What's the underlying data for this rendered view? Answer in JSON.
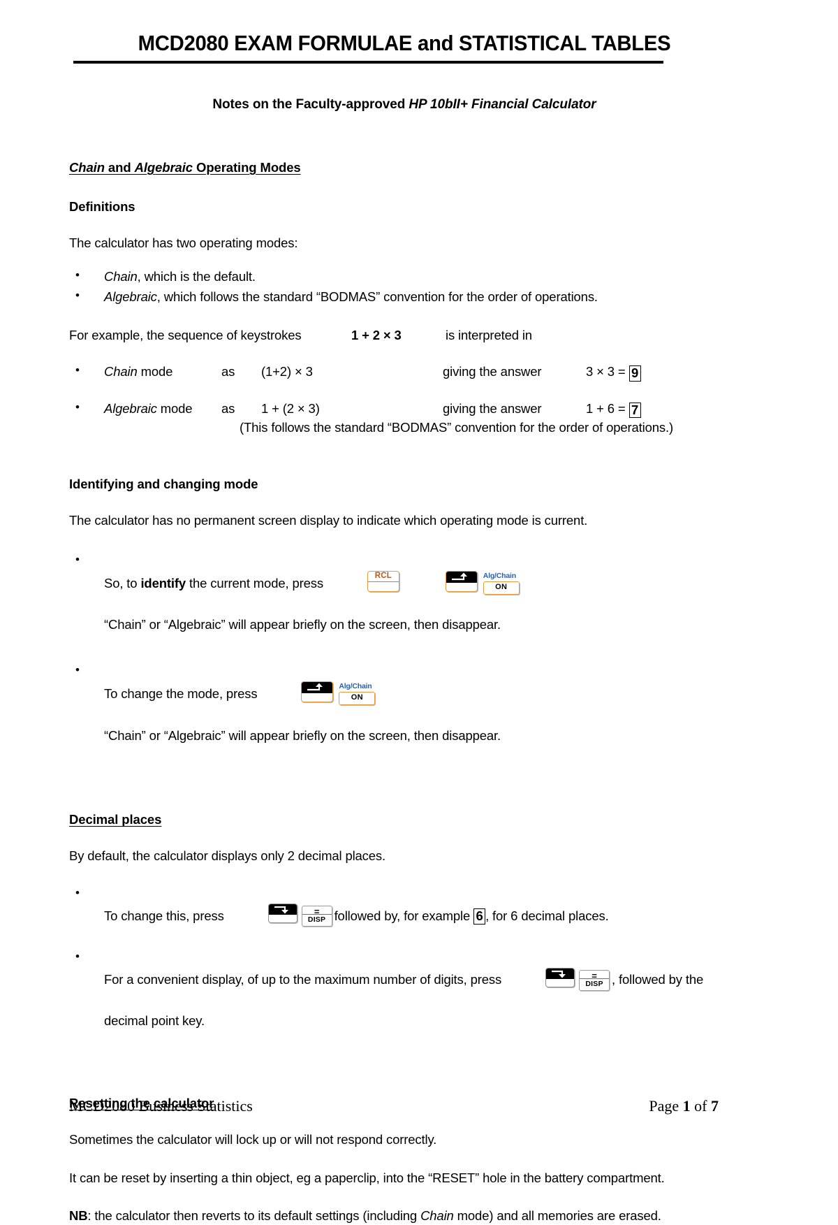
{
  "document": {
    "title": "MCD2080 EXAM FORMULAE and STATISTICAL TABLES",
    "subtitle_prefix": "Notes on the Faculty-approved ",
    "subtitle_calculator": "HP 10bII+ Financial Calculator"
  },
  "sections": {
    "modes": {
      "heading_chain": "Chain",
      "heading_and": " and ",
      "heading_algebraic": "Algebraic",
      "heading_rest": " Operating Modes",
      "definitions_heading": "Definitions",
      "intro": "The calculator has two operating modes:",
      "bullets": [
        {
          "term": "Chain",
          "rest": ", which is the default."
        },
        {
          "term": "Algebraic",
          "rest": ", which follows the standard “BODMAS” convention for the order of operations."
        }
      ],
      "example_prefix": "For example, the sequence of keystrokes",
      "example_keystrokes": "1 + 2 × 3",
      "example_suffix": "is interpreted in",
      "chain_row": {
        "mode": "Chain",
        "mode_suffix": " mode",
        "as": "as",
        "expression": "(1+2) × 3",
        "giving": "giving the answer",
        "result_prefix": "3 × 3 = ",
        "result": "9"
      },
      "algebraic_row": {
        "mode": "Algebraic",
        "mode_suffix": " mode",
        "as": "as",
        "expression": "1 + (2 × 3)",
        "giving": "giving the answer",
        "result_prefix": "1 + 6 = ",
        "result": "7"
      },
      "bodmas_note": "(This follows the standard “BODMAS” convention for the order of operations.)"
    },
    "identify": {
      "heading": "Identifying and changing mode",
      "intro": "The calculator has no permanent screen display to indicate which operating mode is current.",
      "identify_prefix": "So, to ",
      "identify_bold": "identify",
      "identify_rest": " the current mode, press",
      "identify_note": "“Chain” or “Algebraic” will appear briefly on the screen, then disappear.",
      "change_prefix": "To change the mode, press",
      "change_note": "“Chain” or “Algebraic” will appear briefly on the screen, then disappear."
    },
    "decimal": {
      "heading": "Decimal places",
      "intro": "By default, the calculator displays only 2 decimal places.",
      "change_prefix": "To change this, press",
      "change_mid": "followed by, for example ",
      "change_digit": "6",
      "change_suffix": ", for 6 decimal places.",
      "convenient_prefix": "For a convenient display, of up to the maximum number of digits, press",
      "convenient_suffix": ", followed by the",
      "convenient_line2": "decimal point key."
    },
    "reset": {
      "heading": "Resetting the calculator",
      "line1": "Sometimes the calculator will lock up or will not respond correctly.",
      "line2": "It can be reset by inserting a thin object, eg a paperclip, into the “RESET” hole in the battery compartment.",
      "nb_bold": "NB",
      "nb_mid": ": the calculator then reverts to its default settings (including ",
      "nb_italic": "Chain",
      "nb_rest": " mode) and all memories are erased."
    }
  },
  "keys": {
    "rcl": "RCL",
    "on": "ON",
    "alg_chain": "Alg/Chain",
    "disp": "DISP"
  },
  "footer": {
    "left": "MCD2080 Business Statistics",
    "page_label": "Page ",
    "page_number": "1",
    "of_label": " of ",
    "page_total": "7"
  },
  "colors": {
    "key_border_orange": "#e89a42",
    "rcl_text": "#b5581b",
    "alg_chain_blue": "#2c5fa8",
    "text": "#000000",
    "background": "#ffffff"
  }
}
